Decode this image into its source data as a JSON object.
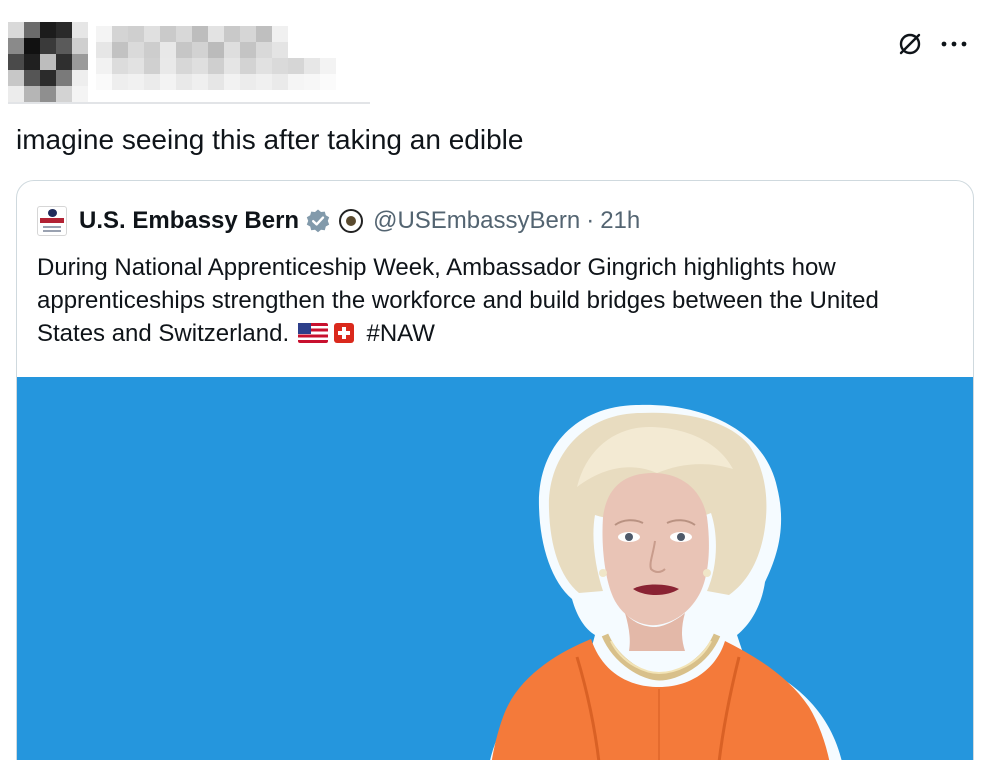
{
  "tweet": {
    "text": "imagine seeing this after taking an edible"
  },
  "actions": {
    "icons": [
      "no-sign-icon",
      "more-horizontal-icon"
    ]
  },
  "quoted": {
    "display_name": "U.S. Embassy Bern",
    "handle": "@USEmbassyBern",
    "separator": "·",
    "time": "21h",
    "body_text": "During National Apprenticeship Week, Ambassador Gingrich highlights how apprenticeships strengthen the workforce and build bridges between the United States and Switzerland.",
    "hashtag": "#NAW",
    "flags": [
      "us-flag-emoji",
      "swiss-flag-emoji"
    ],
    "media_background": "#2596dd"
  },
  "colors": {
    "text": "#0f1419",
    "secondary": "#536471",
    "verified": "#829aab",
    "border": "#cfd9de"
  }
}
